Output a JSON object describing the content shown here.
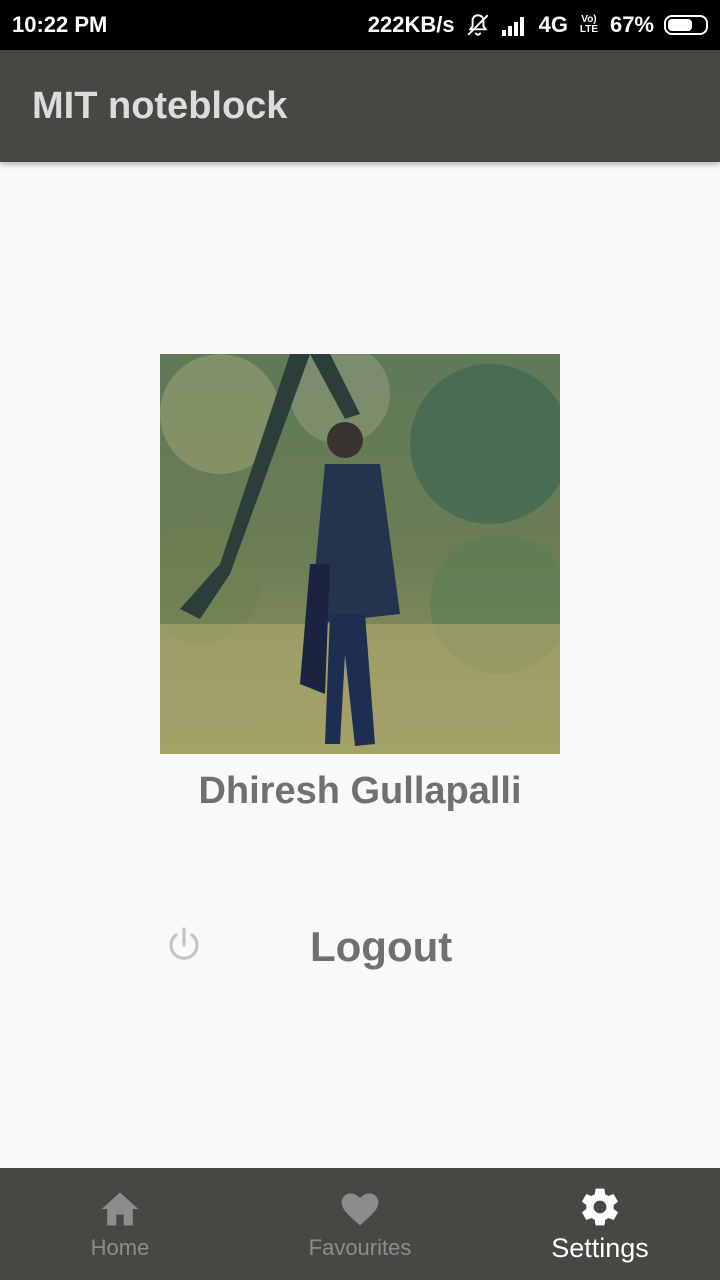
{
  "status_bar": {
    "time": "10:22 PM",
    "net_speed": "222KB/s",
    "network": "4G",
    "volte": "Vo) LTE",
    "battery": "67%",
    "battery_level": 0.67
  },
  "app_bar": {
    "title": "MIT noteblock"
  },
  "profile": {
    "name": "Dhiresh Gullapalli"
  },
  "logout": {
    "label": "Logout"
  },
  "bottom_nav": {
    "items": [
      {
        "label": "Home",
        "icon": "home-icon"
      },
      {
        "label": "Favourites",
        "icon": "heart-icon"
      },
      {
        "label": "Settings",
        "icon": "gear-icon",
        "active": true
      }
    ]
  },
  "colors": {
    "app_bar": "#464843",
    "background": "#f9f9f9",
    "text_gray": "#707070",
    "nav_inactive": "#8c8c8c",
    "nav_active": "#ffffff"
  }
}
